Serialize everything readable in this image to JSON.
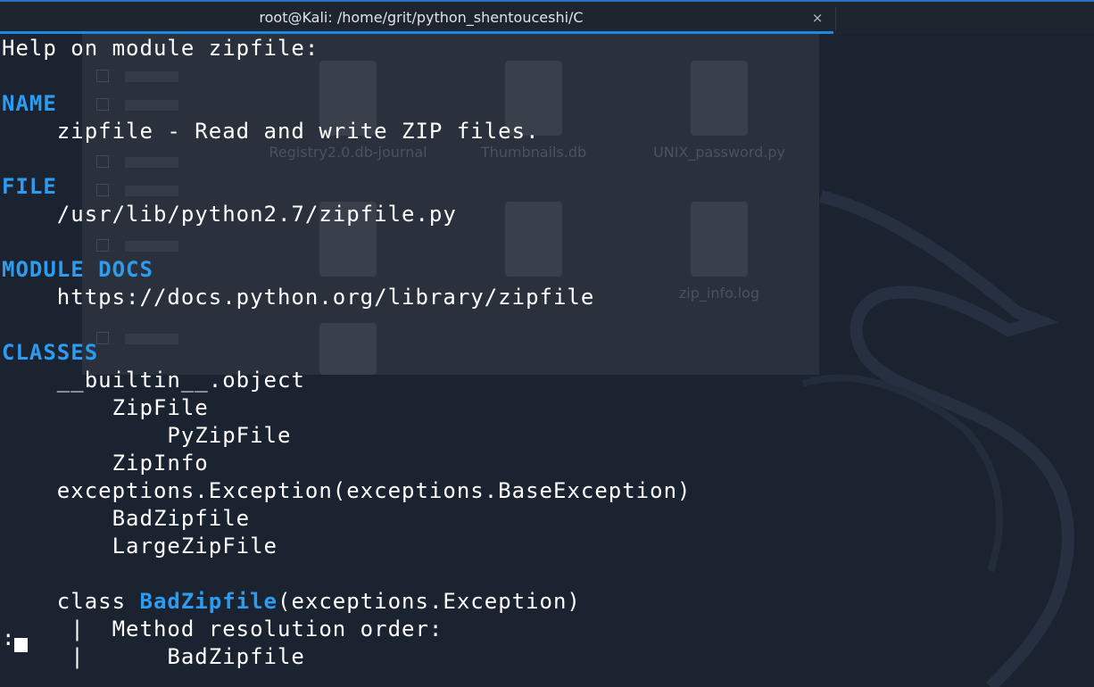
{
  "window": {
    "title": "root@Kali: /home/grit/python_shentouceshi/C",
    "close_glyph": "×"
  },
  "background_files": [
    {
      "label": "Registry2.0.db-journal"
    },
    {
      "label": "Thumbnails.db"
    },
    {
      "label": "UNIX_password.py"
    },
    {
      "label": "zip_info.log"
    }
  ],
  "terminal": {
    "lines": [
      {
        "text": "Help on module zipfile:",
        "style": "normal"
      },
      {
        "text": "",
        "style": "normal"
      },
      {
        "text": "NAME",
        "style": "heading"
      },
      {
        "text": "    zipfile - Read and write ZIP files.",
        "style": "normal"
      },
      {
        "text": "",
        "style": "normal"
      },
      {
        "text": "FILE",
        "style": "heading"
      },
      {
        "text": "    /usr/lib/python2.7/zipfile.py",
        "style": "normal"
      },
      {
        "text": "",
        "style": "normal"
      },
      {
        "text": "MODULE DOCS",
        "style": "heading"
      },
      {
        "text": "    https://docs.python.org/library/zipfile",
        "style": "normal"
      },
      {
        "text": "",
        "style": "normal"
      },
      {
        "text": "CLASSES",
        "style": "heading"
      },
      {
        "text": "    __builtin__.object",
        "style": "normal"
      },
      {
        "text": "        ZipFile",
        "style": "normal"
      },
      {
        "text": "            PyZipFile",
        "style": "normal"
      },
      {
        "text": "        ZipInfo",
        "style": "normal"
      },
      {
        "text": "    exceptions.Exception(exceptions.BaseException)",
        "style": "normal"
      },
      {
        "text": "        BadZipfile",
        "style": "normal"
      },
      {
        "text": "        LargeZipFile",
        "style": "normal"
      },
      {
        "text": "",
        "style": "normal"
      },
      {
        "text": "    class ",
        "style": "class-def",
        "name": "BadZipfile",
        "rest": "(exceptions.Exception)"
      },
      {
        "text": "     |  Method resolution order:",
        "style": "normal"
      },
      {
        "text": "     |      BadZipfile",
        "style": "normal"
      }
    ],
    "prompt": ":"
  },
  "colors": {
    "background": "#1b2330",
    "heading": "#2d9cf0",
    "text": "#ffffff",
    "tab_accent": "#1e88e5"
  }
}
